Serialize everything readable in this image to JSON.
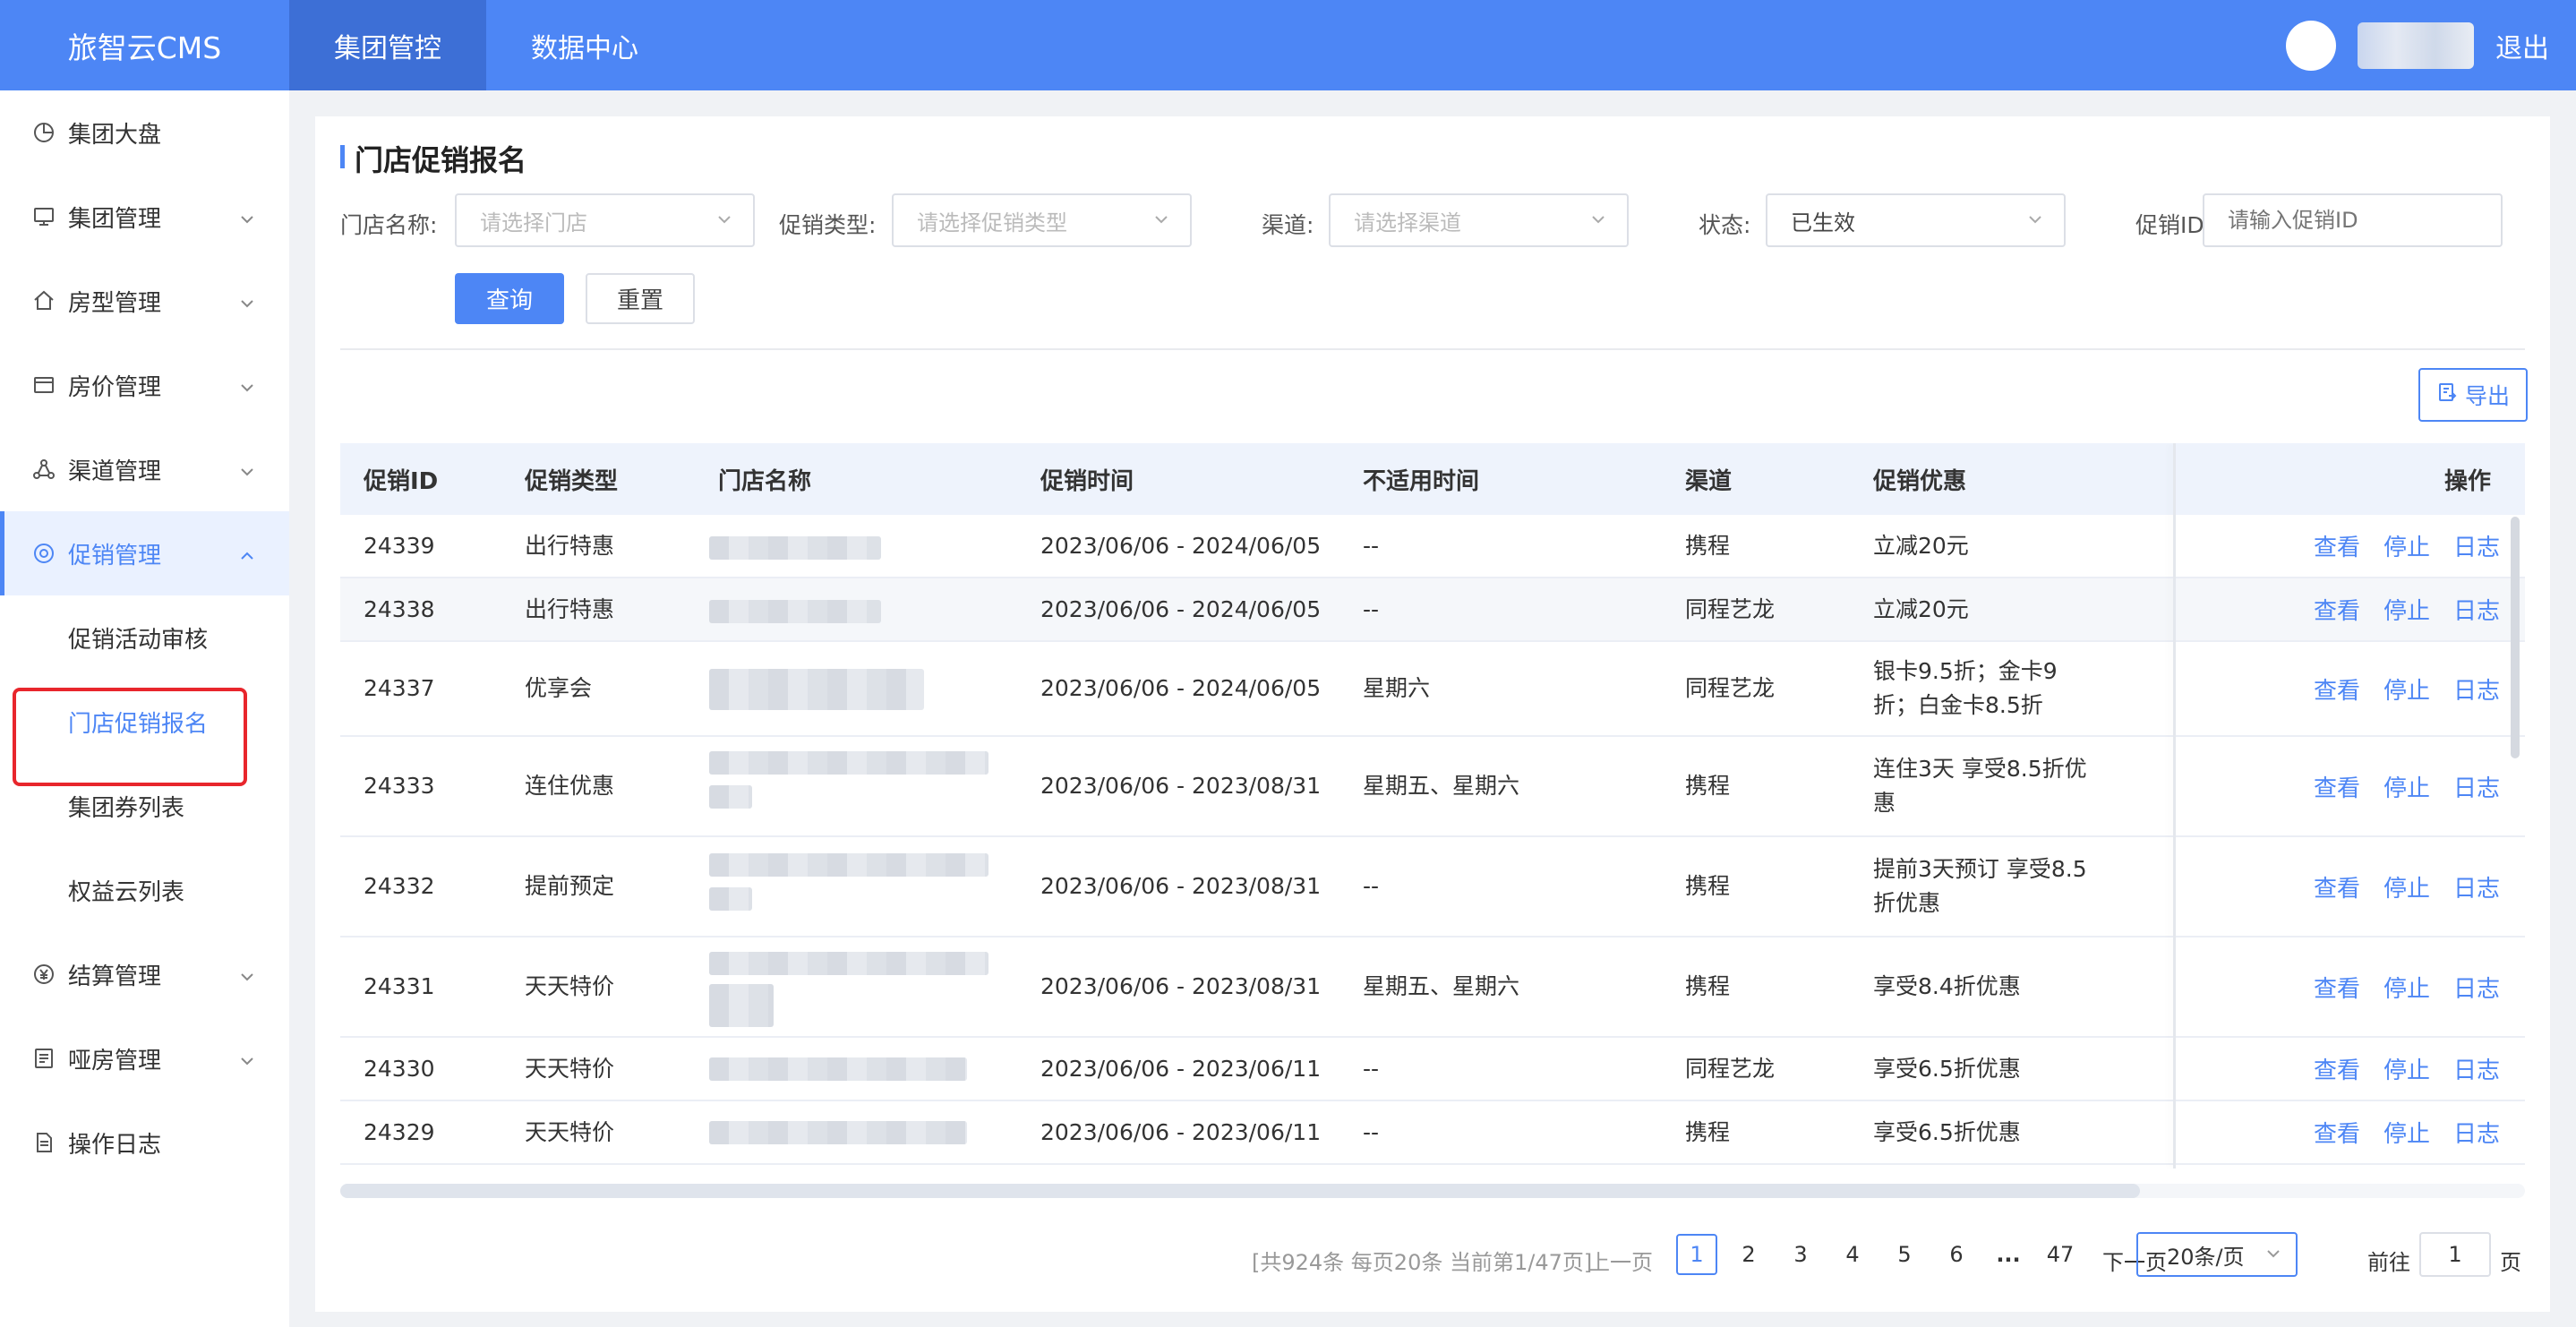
{
  "app": {
    "title": "旅智云CMS"
  },
  "topnav": {
    "tabs": [
      "集团管控",
      "数据中心"
    ],
    "logout": "退出"
  },
  "sidebar": {
    "items": [
      {
        "label": "集团大盘",
        "icon": "pie-chart-icon"
      },
      {
        "label": "集团管理",
        "icon": "monitor-icon"
      },
      {
        "label": "房型管理",
        "icon": "home-icon"
      },
      {
        "label": "房价管理",
        "icon": "card-icon"
      },
      {
        "label": "渠道管理",
        "icon": "share-icon"
      },
      {
        "label": "促销管理",
        "icon": "settings-icon"
      },
      {
        "label": "结算管理",
        "icon": "yen-icon"
      },
      {
        "label": "哑房管理",
        "icon": "document-icon"
      },
      {
        "label": "操作日志",
        "icon": "log-icon"
      }
    ],
    "promo_sub": [
      "促销活动审核",
      "门店促销报名",
      "集团券列表",
      "权益云列表"
    ]
  },
  "page": {
    "title": "门店促销报名",
    "filters": {
      "store_label": "门店名称:",
      "store_placeholder": "请选择门店",
      "type_label": "促销类型:",
      "type_placeholder": "请选择促销类型",
      "channel_label": "渠道:",
      "channel_placeholder": "请选择渠道",
      "status_label": "状态:",
      "status_value": "已生效",
      "id_label": "促销ID:",
      "id_placeholder": "请输入促销ID"
    },
    "buttons": {
      "query": "查询",
      "reset": "重置",
      "export": "导出"
    }
  },
  "table": {
    "headers": [
      "促销ID",
      "促销类型",
      "门店名称",
      "促销时间",
      "不适用时间",
      "渠道",
      "促销优惠",
      "操作"
    ],
    "actions": [
      "查看",
      "停止",
      "日志"
    ],
    "rows": [
      {
        "id": "24339",
        "type": "出行特惠",
        "time": "2023/06/06 - 2024/06/05",
        "exclude": "--",
        "channel": "携程",
        "offer": "立减20元"
      },
      {
        "id": "24338",
        "type": "出行特惠",
        "time": "2023/06/06 - 2024/06/05",
        "exclude": "--",
        "channel": "同程艺龙",
        "offer": "立减20元"
      },
      {
        "id": "24337",
        "type": "优享会",
        "time": "2023/06/06 - 2024/06/05",
        "exclude": "星期六",
        "channel": "同程艺龙",
        "offer": "银卡9.5折；金卡9折；白金卡8.5折"
      },
      {
        "id": "24333",
        "type": "连住优惠",
        "time": "2023/06/06 - 2023/08/31",
        "exclude": "星期五、星期六",
        "channel": "携程",
        "offer": "连住3天 享受8.5折优惠"
      },
      {
        "id": "24332",
        "type": "提前预定",
        "time": "2023/06/06 - 2023/08/31",
        "exclude": "--",
        "channel": "携程",
        "offer": "提前3天预订 享受8.5折优惠"
      },
      {
        "id": "24331",
        "type": "天天特价",
        "time": "2023/06/06 - 2023/08/31",
        "exclude": "星期五、星期六",
        "channel": "携程",
        "offer": "享受8.4折优惠"
      },
      {
        "id": "24330",
        "type": "天天特价",
        "time": "2023/06/06 - 2023/06/11",
        "exclude": "--",
        "channel": "同程艺龙",
        "offer": "享受6.5折优惠"
      },
      {
        "id": "24329",
        "type": "天天特价",
        "time": "2023/06/06 - 2023/06/11",
        "exclude": "--",
        "channel": "携程",
        "offer": "享受6.5折优惠"
      }
    ]
  },
  "pagination": {
    "summary": "[共924条 每页20条 当前第1/47页]",
    "prev": "上一页",
    "pages": [
      "1",
      "2",
      "3",
      "4",
      "5",
      "6",
      "...",
      "47"
    ],
    "current": "1",
    "next": "下一页",
    "page_size": "20条/页",
    "goto_label": "前往",
    "goto_value": "1",
    "goto_suffix": "页"
  },
  "colors": {
    "primary": "#4d86f5",
    "highlight_box": "#e8262c"
  }
}
